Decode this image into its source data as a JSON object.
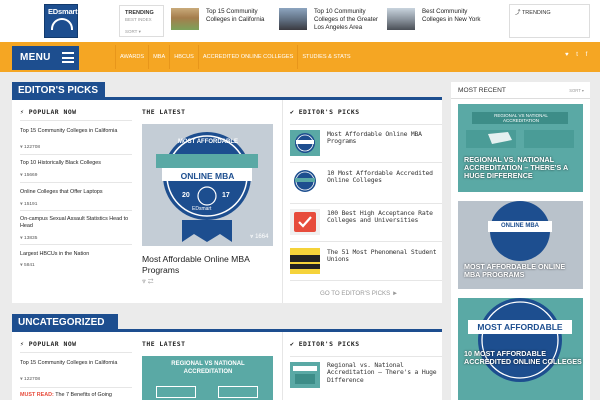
{
  "brand": {
    "logo_text": "EDsmart"
  },
  "topbar": {
    "trending_label": "TRENDING",
    "best_index": "BEST INDEX",
    "sort_label": "SORT ▾",
    "stories": [
      {
        "title": "Top 15 Community Colleges in California"
      },
      {
        "title": "Top 10 Community Colleges of the Greater Los Angeles Area"
      },
      {
        "title": "Best Community Colleges in New York"
      }
    ],
    "right_trending_label": "TRENDING"
  },
  "nav": {
    "menu_label": "MENU",
    "items": [
      "AWARDS",
      "MBA",
      "HBCUS",
      "ACCREDITED ONLINE COLLEGES",
      "STUDIES & STATS"
    ],
    "social": "♥ t f"
  },
  "section1": {
    "title": "EDITOR'S PICKS",
    "popular_now_label": "POPULAR NOW",
    "popular": [
      {
        "title": "Top 15 Community Colleges in California",
        "count": "122708"
      },
      {
        "title": "Top 10 Historically Black Colleges",
        "count": "15669"
      },
      {
        "title": "Online Colleges that Offer Laptops",
        "count": "15191"
      },
      {
        "title": "On-campus Sexual Assault Statistics Head to Head",
        "count": "13835"
      },
      {
        "title": "Largest HBCUs in the Nation",
        "count": "5841"
      }
    ],
    "latest_label": "THE LATEST",
    "feature": {
      "title": "Most Affordable Online MBA Programs",
      "views": "1664",
      "badge_top": "MOST AFFORDABLE",
      "badge_mid": "ONLINE MBA",
      "badge_year_l": "20",
      "badge_year_r": "17",
      "badge_brand": "EDsmart"
    },
    "editors_label": "EDITOR'S PICKS",
    "editors": [
      {
        "title": "Most Affordable Online MBA Programs"
      },
      {
        "title": "10 Most Affordable Accredited Online Colleges"
      },
      {
        "title": "100 Best High Acceptance Rate Colleges and Universities"
      },
      {
        "title": "The 51 Most Phenomenal Student Unions"
      }
    ],
    "go_to_label": "GO TO EDITOR'S PICKS ►"
  },
  "section2": {
    "title": "UNCATEGORIZED",
    "popular_now_label": "POPULAR NOW",
    "popular": [
      {
        "title": "Top 15 Community Colleges in California",
        "count": "122708"
      }
    ],
    "must_read_label": "MUST READ:",
    "must_read_text": "The 7 Benefits of Going",
    "latest_label": "THE LATEST",
    "latest_thumb_text": "REGIONAL VS NATIONAL ACCREDITATION",
    "editors_label": "EDITOR'S PICKS",
    "editors": [
      {
        "title": "Regional vs. National Accreditation – There's a Huge Difference"
      }
    ]
  },
  "sidebar": {
    "title": "MOST RECENT",
    "sort_label": "SORT ▾",
    "cards": [
      {
        "title": "REGIONAL VS. NATIONAL ACCREDITATION – THERE'S A HUGE DIFFERENCE",
        "thumb_text": "REGIONAL VS NATIONAL ACCREDITATION"
      },
      {
        "title": "MOST AFFORDABLE ONLINE MBA PROGRAMS",
        "thumb_text": "ONLINE MBA"
      },
      {
        "title": "10 MOST AFFORDABLE ACCREDITED ONLINE COLLEGES",
        "thumb_text": "MOST AFFORDABLE"
      }
    ]
  },
  "colors": {
    "brand_blue": "#1d4e8f",
    "nav_orange": "#f5a623",
    "teal": "#5aa9a5"
  }
}
